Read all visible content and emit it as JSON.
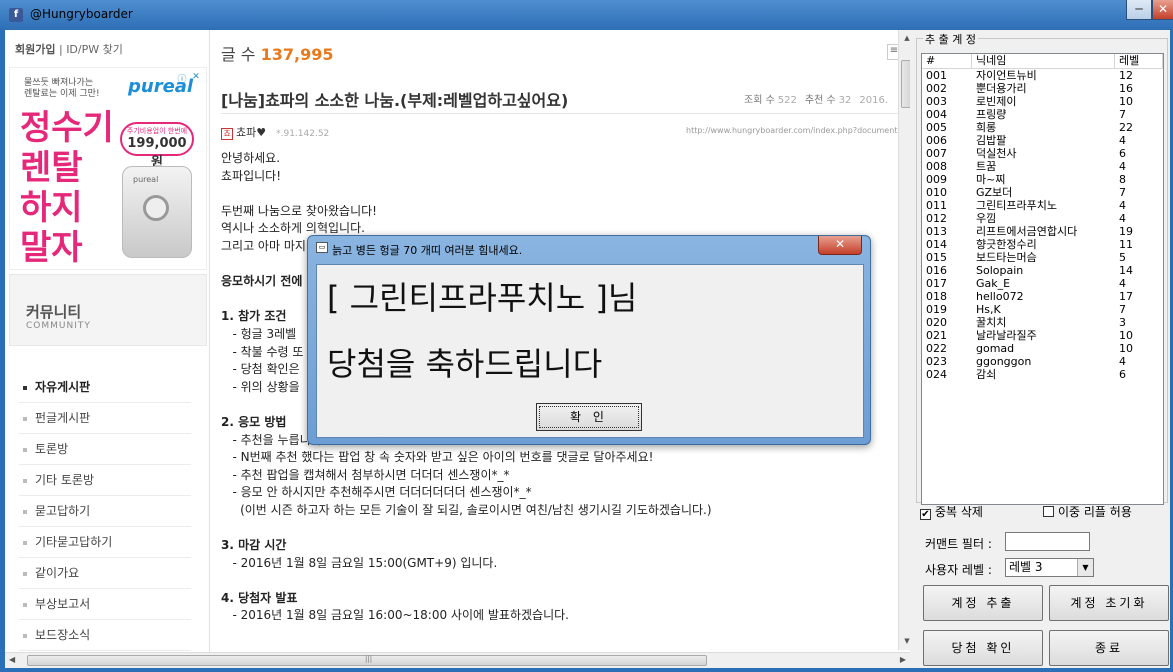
{
  "window": {
    "title": "@Hungryboarder",
    "min": "─",
    "close": "✕"
  },
  "nav": {
    "signup": "회원가입",
    "sep": " | ",
    "findid": "ID/PW 찾기",
    "ad": {
      "small1": "물쓰듯 빠져나가는",
      "small2": "렌탈료는 이제 그만!",
      "brand": "pureal",
      "big1": "정수기",
      "big2": "렌탈",
      "big3": "하지",
      "big4": "말자",
      "bubble_top": "주기비용업이 한번에",
      "bubble_price": "199,000원",
      "device": "pureal",
      "info": "ⓘ",
      "x": "✕"
    },
    "community": {
      "title": "커뮤니티",
      "sub": "COMMUNITY"
    },
    "menu": [
      "자유게시판",
      "펀글게시판",
      "토론방",
      "기타 토론방",
      "묻고답하기",
      "기타묻고답하기",
      "같이가요",
      "부상보고서",
      "보드장소식"
    ]
  },
  "post": {
    "count_label": "글 수 ",
    "count": "137,995",
    "list_icon": "≡",
    "title": "[나눔]쵸파의 소소한 나눔.(부제:레벨업하고싶어요)",
    "views_label": "조회 수",
    "views": "522",
    "rec_label": "추천 수",
    "rec": "32",
    "date": "2016.",
    "author": "쵸파♥",
    "avatar": "쵸",
    "ip": "*.91.142.52",
    "url": "http://www.hungryboarder.com/index.php?document",
    "lines": [
      "안녕하세요.",
      "쵸파입니다!",
      "",
      "두번째 나눔으로 찾아왔습니다!",
      "역시나 소소하게 의혁입니다.",
      "그리고 아마 마지",
      "",
      "응모하시기 전에",
      "",
      "1. 참가 조건",
      "   - 헝글 3레벨",
      "   - 착불 수령 또",
      "   - 당첨 확인은",
      "   - 위의 상황을",
      "",
      "2. 응모 방법",
      "   - 추천을 누릅니다.",
      "   - N번째 추천 했다는 팝업 창 속 숫자와 받고 싶은 아이의 번호를 댓글로 달아주세요!",
      "   - 추천 팝업을 캡쳐해서 첨부하시면 더더더 센스쟁이*_*",
      "   - 응모 안 하시지만 추천해주시면 더더더더더더 센스쟁이*_*",
      "     (이번 시즌 하고자 하는 모든 기술이 잘 되길, 솔로이시면 여친/남친 생기시길 기도하겠습니다.)",
      "",
      "3. 마감 시간",
      "   - 2016년 1월 8일 금요일 15:00(GMT+9) 입니다.",
      "",
      "4. 당첨자 발표",
      "   - 2016년 1월 8일 금요일 16:00~18:00 사이에 발표하겠습니다."
    ]
  },
  "panel": {
    "group": "추 출 계 정",
    "headers": [
      "#",
      "닉네임",
      "레벨"
    ],
    "rows": [
      [
        "001",
        "자이언트뉴비",
        "12"
      ],
      [
        "002",
        "뿐더용가리",
        "16"
      ],
      [
        "003",
        "로빈제이",
        "10"
      ],
      [
        "004",
        "프링량",
        "7"
      ],
      [
        "005",
        "희롱",
        "22"
      ],
      [
        "006",
        "김밥팔",
        "4"
      ],
      [
        "007",
        "덕실천사",
        "6"
      ],
      [
        "008",
        "트꿈",
        "4"
      ],
      [
        "009",
        "마~찌",
        "8"
      ],
      [
        "010",
        "GZ보더",
        "7"
      ],
      [
        "011",
        "그린티프라푸치노",
        "4"
      ],
      [
        "012",
        "우낌",
        "4"
      ],
      [
        "013",
        "리프트에서금연합시다",
        "19"
      ],
      [
        "014",
        "향긋한정수리",
        "11"
      ],
      [
        "015",
        "보드타는머슴",
        "5"
      ],
      [
        "016",
        "Solopain",
        "14"
      ],
      [
        "017",
        "Gak_E",
        "4"
      ],
      [
        "018",
        "hello072",
        "17"
      ],
      [
        "019",
        "Hs,K",
        "7"
      ],
      [
        "020",
        "꿀치치",
        "3"
      ],
      [
        "021",
        "날라날라질주",
        "10"
      ],
      [
        "022",
        "gomad",
        "10"
      ],
      [
        "023",
        "ggonggon",
        "4"
      ],
      [
        "024",
        "감쇠",
        "6"
      ]
    ],
    "dup_label": "중복 삭제",
    "dup_checked": "✔",
    "reply_label": "이중 리플 허용",
    "comment_filter": "커맨트 필터 :",
    "user_level": "사용자 레벨 :",
    "level_value": "레벨 3",
    "combo_arrow": "▼",
    "btn_extract": "계정 추출",
    "btn_reset": "계정 초기화",
    "btn_confirm": "당첨 확인",
    "btn_exit": "종료"
  },
  "dialog": {
    "title": "늙고 병든 헝글 70 개띠 여러분 힘내세요.",
    "line1": "[ 그린티프라푸치노 ]님",
    "line2": "당첨을 축하드립니다",
    "ok": "확 인",
    "close": "✕"
  }
}
